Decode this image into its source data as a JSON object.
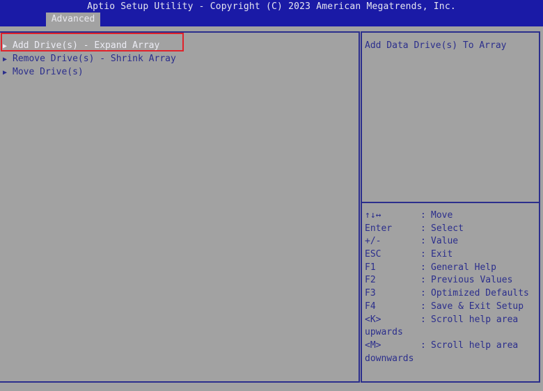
{
  "header": {
    "title": "Aptio Setup Utility - Copyright (C) 2023 American Megatrends, Inc.",
    "tab": "Advanced"
  },
  "menu": {
    "items": [
      {
        "label": "Add Drive(s) - Expand Array",
        "selected": true
      },
      {
        "label": "Remove Drive(s) - Shrink Array",
        "selected": false
      },
      {
        "label": "Move Drive(s)",
        "selected": false
      }
    ],
    "arrow_icon": "triangle-right-icon"
  },
  "help": {
    "text": "Add Data Drive(s) To Array"
  },
  "keys": [
    {
      "key": "↑↓↔",
      "desc": "Move"
    },
    {
      "key": "Enter",
      "desc": "Select"
    },
    {
      "key": "+/-",
      "desc": "Value"
    },
    {
      "key": "ESC",
      "desc": "Exit"
    },
    {
      "key": "F1",
      "desc": "General Help"
    },
    {
      "key": "F2",
      "desc": "Previous Values"
    },
    {
      "key": "F3",
      "desc": "Optimized Defaults"
    },
    {
      "key": "F4",
      "desc": "Save & Exit Setup"
    },
    {
      "key": "<K>",
      "desc": "Scroll help area"
    },
    {
      "key": "upwards",
      "desc": ""
    },
    {
      "key": "<M>",
      "desc": "Scroll help area"
    },
    {
      "key": "downwards",
      "desc": ""
    }
  ],
  "colors": {
    "header_bg": "#1a1aa6",
    "panel_bg": "#a2a2a2",
    "text": "#2b2e8c",
    "selected_text": "#ececf4",
    "highlight_border": "#e0212a"
  }
}
